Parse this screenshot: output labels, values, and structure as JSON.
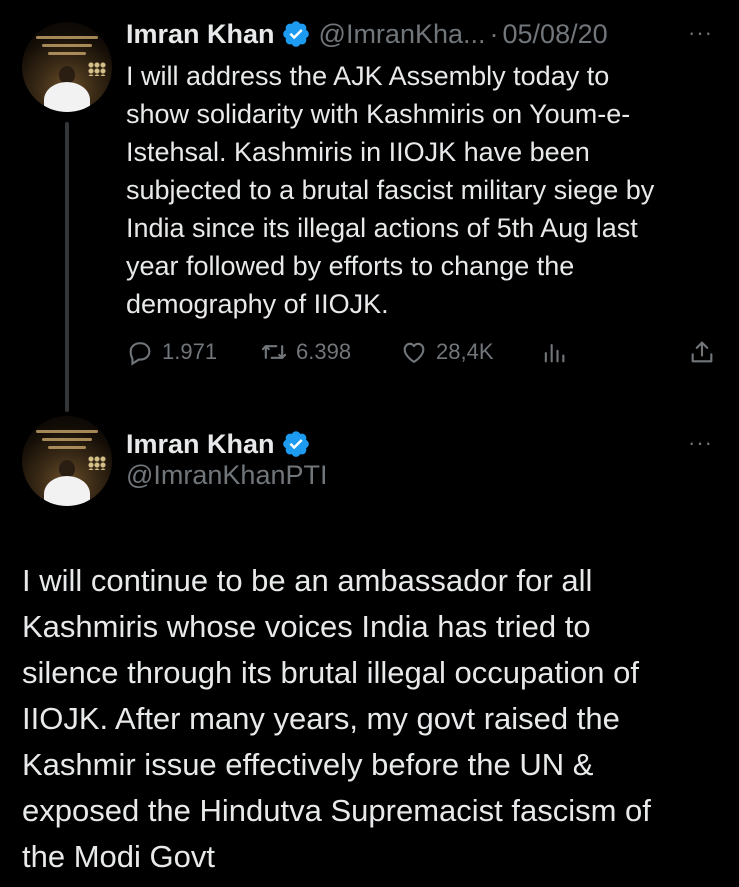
{
  "tweet1": {
    "name": "Imran Khan",
    "handle": "@ImranKha...",
    "separator": "·",
    "date": "05/08/20",
    "more": "···",
    "text": "I will address the AJK Assembly today to\nshow solidarity with Kashmiris on Youm-e-\nIstehsal. Kashmiris in IIOJK have been\nsubjected to a brutal fascist military siege by\nIndia since its illegal actions of 5th Aug last\nyear followed by efforts to change the\ndemography of IIOJK.",
    "replies": "1.971",
    "reposts": "6.398",
    "likes": "28,4K",
    "icons": [
      "reply-icon",
      "repost-icon",
      "like-icon",
      "views-icon",
      "share-icon"
    ]
  },
  "tweet2": {
    "name": "Imran Khan",
    "handle": "@ImranKhanPTI",
    "more": "···",
    "text": "I will continue to be an ambassador for all\nKashmiris whose voices India has tried to\nsilence through its brutal illegal occupation of\nIIOJK. After many years, my govt raised the\nKashmir issue effectively before the UN &\nexposed the Hindutva Supremacist fascism of\nthe Modi Govt"
  },
  "colors": {
    "background": "#000000",
    "text": "#e7e9ea",
    "secondary": "#71767b",
    "verified": "#1d9bf0",
    "thread_line": "#333639"
  }
}
